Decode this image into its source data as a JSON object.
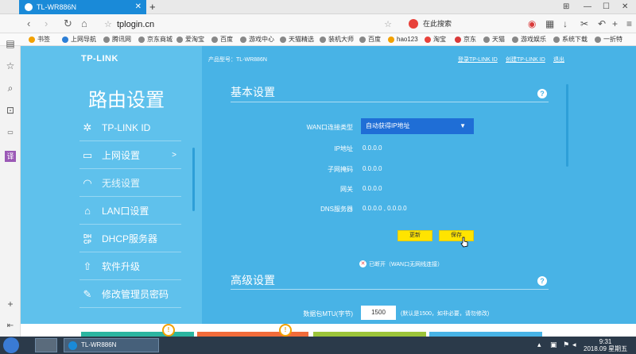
{
  "browser": {
    "tab_title": "TL-WR886N",
    "tab_close": "✕",
    "new_tab": "+",
    "address": "tplogin.cn",
    "search_placeholder": "在此搜索",
    "window_controls": [
      "⊞",
      "—",
      "☐",
      "✕"
    ]
  },
  "bookmarks": [
    "书签",
    "上网导航",
    "腾讯网",
    "京东商城",
    "爱淘宝",
    "百度",
    "游戏中心",
    "天猫精选",
    "装机大师",
    "百度",
    "hao123",
    "淘宝",
    "京东",
    "天猫",
    "游戏娱乐",
    "系统下载",
    "一折特"
  ],
  "router": {
    "logo": "TP-LINK",
    "title": "路由设置",
    "model_label": "产品型号：TL-WR886N",
    "links": [
      "登录TP-LINK ID",
      "创建TP-LINK ID",
      "退出"
    ],
    "menu": [
      {
        "label": "TP-LINK ID",
        "icon": "gear-icon"
      },
      {
        "label": "上网设置",
        "icon": "laptop-icon",
        "arrow": ">"
      },
      {
        "label": "无线设置",
        "icon": "wifi-icon"
      },
      {
        "label": "LAN口设置",
        "icon": "lan-icon"
      },
      {
        "label": "DHCP服务器",
        "icon": "dhcp-icon"
      },
      {
        "label": "软件升级",
        "icon": "upgrade-icon"
      },
      {
        "label": "修改管理员密码",
        "icon": "pencil-icon"
      }
    ],
    "basic": {
      "title": "基本设置",
      "wan_type_label": "WAN口连接类型",
      "wan_type_value": "自动获得IP地址",
      "ip_label": "IP地址",
      "ip_value": "0.0.0.0",
      "mask_label": "子网掩码",
      "mask_value": "0.0.0.0",
      "gateway_label": "网关",
      "gateway_value": "0.0.0.0",
      "dns_label": "DNS服务器",
      "dns_value": "0.0.0.0 , 0.0.0.0",
      "refresh_btn": "更新",
      "save_btn": "保存",
      "status": "已断开（WAN口无网线连接）"
    },
    "advanced": {
      "title": "高级设置",
      "mtu_label": "数据包MTU(字节)",
      "mtu_value": "1500",
      "mtu_hint": "(默认是1500，如非必要，请勿修改)"
    }
  },
  "bottom_badges": [
    "!",
    "!"
  ],
  "taskbar": {
    "app_label": "TL-WR886N",
    "time": "9:31",
    "date": "2018.09 星期五"
  }
}
